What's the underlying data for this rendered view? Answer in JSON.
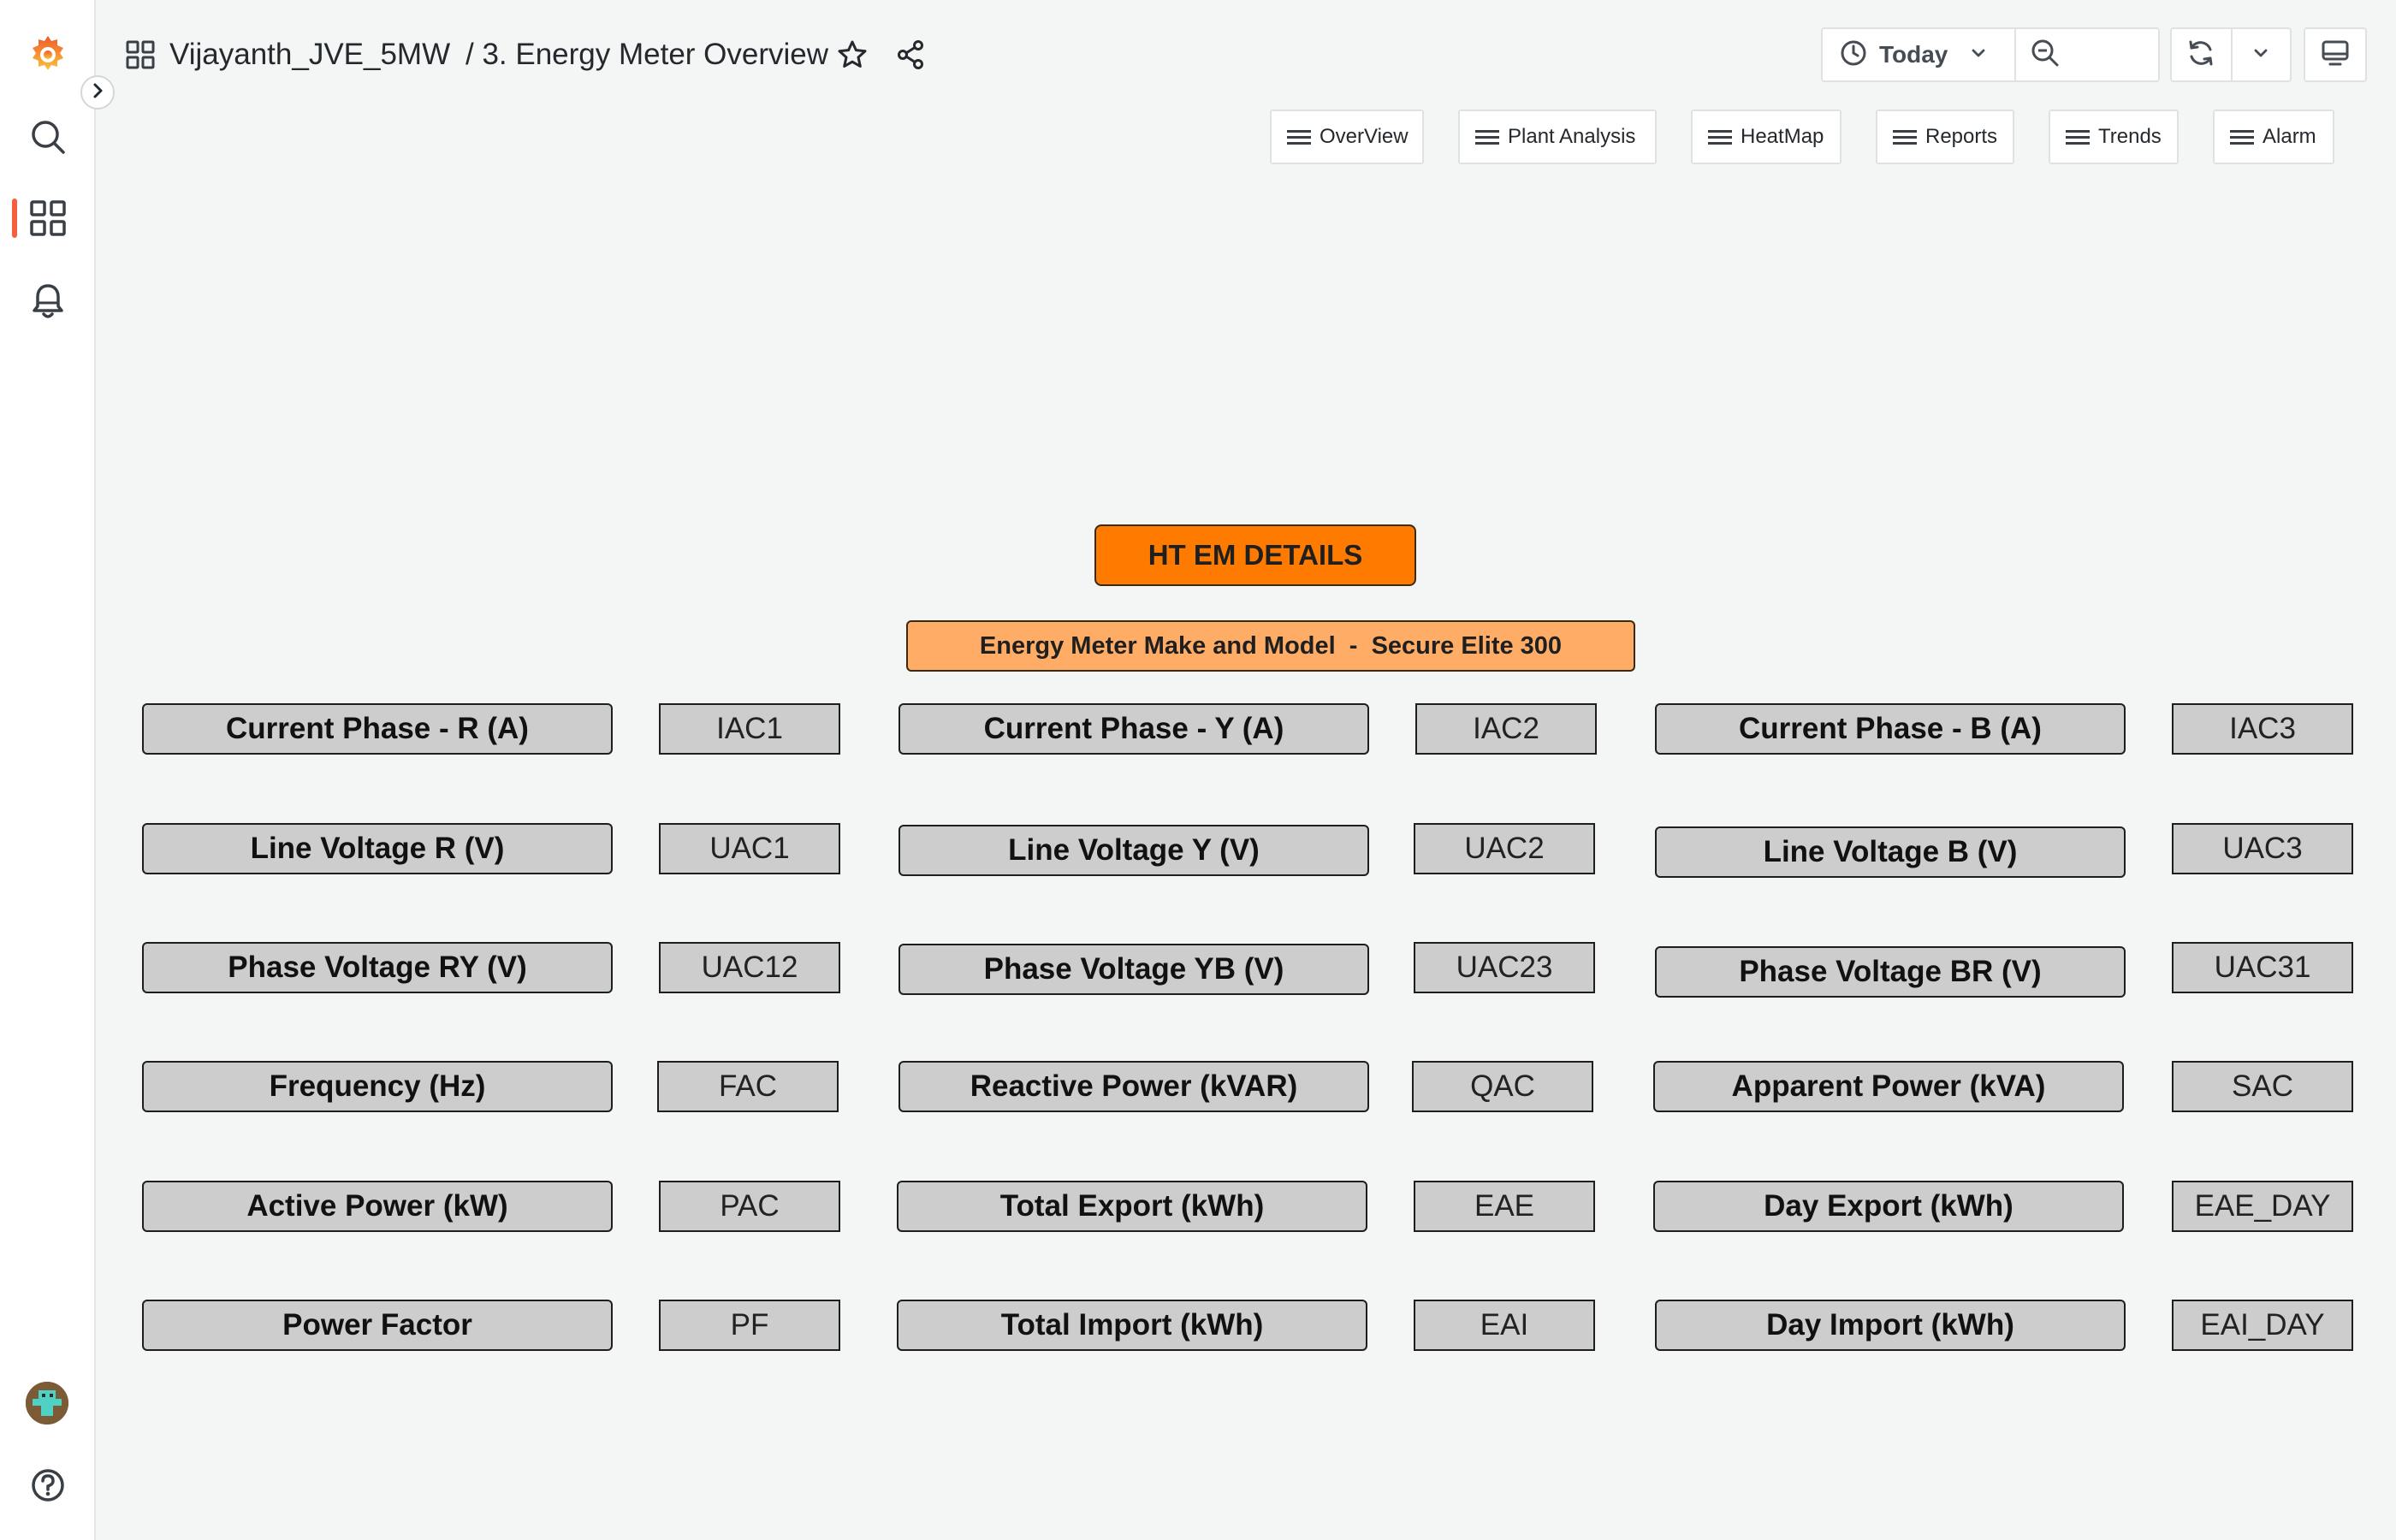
{
  "app": {
    "breadcrumb_folder": "Vijayanth_JVE_5MW",
    "breadcrumb_page": "/ 3. Energy Meter Overview"
  },
  "sidebar": {
    "items": [
      {
        "icon": "grafana-logo-icon"
      },
      {
        "icon": "search-icon"
      },
      {
        "icon": "dashboards-icon",
        "active": true
      },
      {
        "icon": "bell-icon"
      }
    ],
    "bottom": [
      {
        "icon": "user-avatar"
      },
      {
        "icon": "help-icon"
      }
    ]
  },
  "toolbar": {
    "time_range": "Today",
    "icons": [
      "clock-icon",
      "chevron-down-icon",
      "zoom-out-icon",
      "refresh-icon",
      "chevron-down-icon",
      "tv-mode-icon",
      "star-icon",
      "share-icon"
    ]
  },
  "nav_links": [
    {
      "label": "OverView"
    },
    {
      "label": "Plant Analysis"
    },
    {
      "label": "HeatMap"
    },
    {
      "label": "Reports"
    },
    {
      "label": "Trends"
    },
    {
      "label": "Alarm"
    }
  ],
  "panel": {
    "title": "HT EM DETAILS",
    "meter_model": "Energy Meter Make and Model  -  Secure Elite 300",
    "rows": [
      [
        {
          "label": "Current Phase - R (A)",
          "value": "IAC1"
        },
        {
          "label": "Current Phase - Y (A)",
          "value": "IAC2"
        },
        {
          "label": "Current Phase - B (A)",
          "value": "IAC3"
        }
      ],
      [
        {
          "label": "Line Voltage R (V)",
          "value": "UAC1"
        },
        {
          "label": "Line Voltage Y (V)",
          "value": "UAC2"
        },
        {
          "label": "Line Voltage B (V)",
          "value": "UAC3"
        }
      ],
      [
        {
          "label": "Phase Voltage RY (V)",
          "value": "UAC12"
        },
        {
          "label": "Phase Voltage YB (V)",
          "value": "UAC23"
        },
        {
          "label": "Phase Voltage BR (V)",
          "value": "UAC31"
        }
      ],
      [
        {
          "label": "Frequency (Hz)",
          "value": "FAC"
        },
        {
          "label": "Reactive Power (kVAR)",
          "value": "QAC"
        },
        {
          "label": "Apparent Power (kVA)",
          "value": "SAC"
        }
      ],
      [
        {
          "label": "Active Power (kW)",
          "value": "PAC"
        },
        {
          "label": "Total Export (kWh)",
          "value": "EAE"
        },
        {
          "label": "Day Export (kWh)",
          "value": "EAE_DAY"
        }
      ],
      [
        {
          "label": "Power Factor",
          "value": "PF"
        },
        {
          "label": "Total Import (kWh)",
          "value": "EAI"
        },
        {
          "label": "Day Import (kWh)",
          "value": "EAI_DAY"
        }
      ]
    ]
  },
  "colors": {
    "accent": "#f55f3e",
    "title_bg": "#ff7b00",
    "model_bg": "#ffad66",
    "cell_bg": "#cdcdcd"
  }
}
